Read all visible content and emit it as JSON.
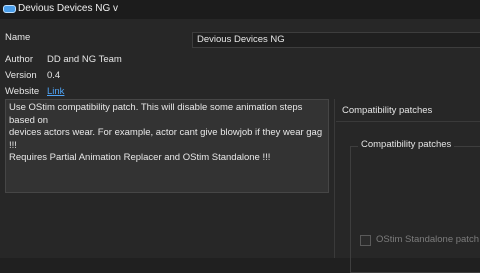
{
  "window": {
    "title": "Devious Devices NG v"
  },
  "fields": {
    "name_label": "Name",
    "name_value": "Devious Devices NG",
    "author_label": "Author",
    "author_value": "DD and NG Team",
    "version_label": "Version",
    "version_value": "0.4",
    "website_label": "Website",
    "website_link": "Link"
  },
  "description": "Use OStim compatibility patch. This will disable some animation steps based on\ndevices actors wear. For example, actor cant give blowjob if they wear gag !!!\nRequires Partial Animation Replacer and OStim Standalone !!!",
  "panel": {
    "outer_title": "Compatibility patches",
    "inner_title": "Compatibility patches",
    "checkbox_label": "OStim Standalone patch",
    "checkbox_checked": false
  },
  "icons": {
    "app": "app-logo-icon"
  },
  "colors": {
    "link": "#4ea3f5",
    "background": "#272727"
  }
}
